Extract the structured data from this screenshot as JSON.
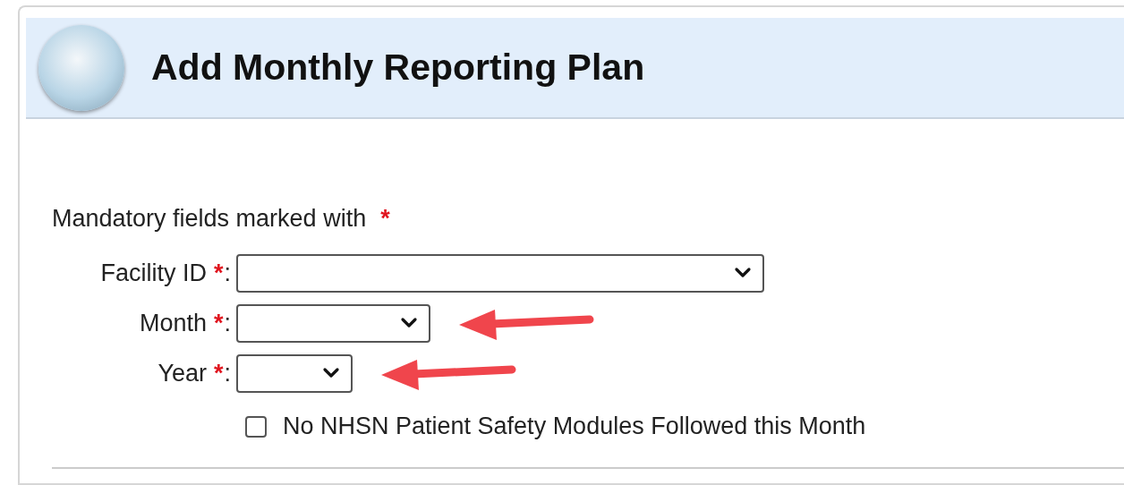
{
  "header": {
    "title": "Add Monthly Reporting Plan"
  },
  "mandatory_note": {
    "text": "Mandatory fields marked with",
    "mark": "*"
  },
  "fields": [
    {
      "label": "Facility ID",
      "required_mark": "*",
      "separator": ":",
      "annotated": false
    },
    {
      "label": "Month",
      "required_mark": "*",
      "separator": ":",
      "annotated": true
    },
    {
      "label": "Year",
      "required_mark": "*",
      "separator": ":",
      "annotated": true
    }
  ],
  "checkbox": {
    "label": "No NHSN Patient Safety Modules Followed this Month",
    "checked": false
  }
}
